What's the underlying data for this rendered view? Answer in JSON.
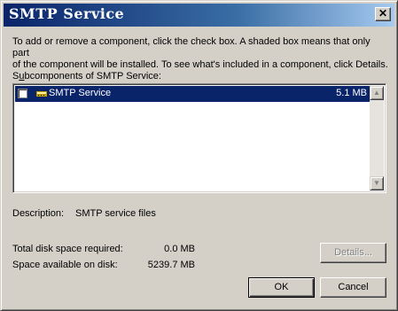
{
  "window": {
    "title": "SMTP Service",
    "close_label": "✕"
  },
  "instructions": "To add or remove a component, click the check box. A shaded box means that only part\nof the component will be installed. To see what's included in a component, click Details.",
  "subcomponents": {
    "label_mnemonic": "u",
    "label_prefix": "S",
    "label_suffix": "bcomponents of SMTP Service:",
    "items": [
      {
        "name": "SMTP Service",
        "size": "5.1 MB",
        "checked": false,
        "selected": true
      }
    ]
  },
  "description": {
    "label": "Description:",
    "value": "SMTP service files"
  },
  "disk": {
    "required_label": "Total disk space required:",
    "required_value": "0.0 MB",
    "available_label": "Space available on disk:",
    "available_value": "5239.7 MB"
  },
  "buttons": {
    "details": "Details...",
    "ok": "OK",
    "cancel": "Cancel"
  },
  "colors": {
    "titlebar_start": "#0a246a",
    "titlebar_end": "#a6caf0",
    "selection": "#0a246a",
    "face": "#d4d0c8"
  }
}
